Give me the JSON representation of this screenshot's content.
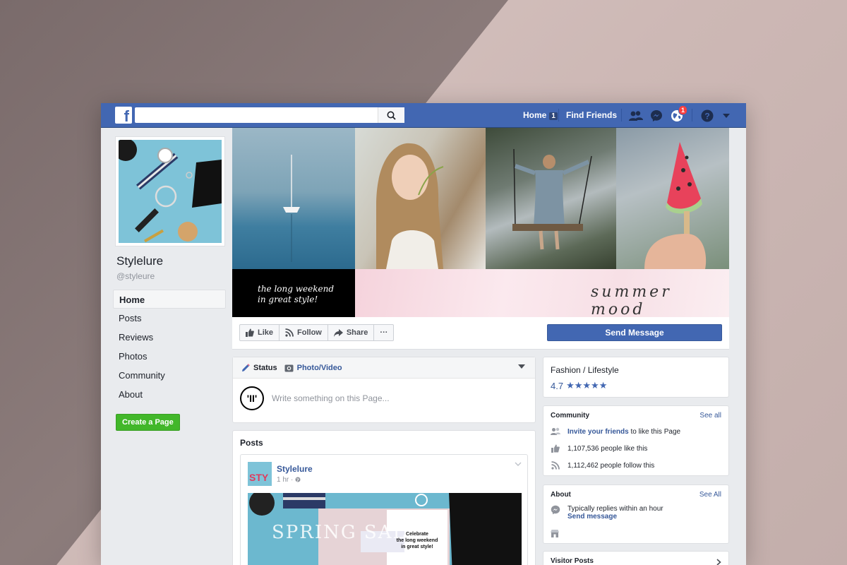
{
  "topbar": {
    "logo": "f",
    "search_placeholder": "",
    "home_label": "Home",
    "home_count": "1",
    "find_friends_label": "Find Friends",
    "notification_count": "1"
  },
  "page": {
    "name": "Stylelure",
    "handle": "@styleure"
  },
  "left_nav": {
    "items": [
      "Home",
      "Posts",
      "Reviews",
      "Photos",
      "Community",
      "About"
    ],
    "create_page": "Create a Page"
  },
  "cover": {
    "black_line1": "the long weekend",
    "black_line2": "in great style!",
    "script_text": "summer mood"
  },
  "actions": {
    "like": "Like",
    "follow": "Follow",
    "share": "Share",
    "more": "···",
    "send_message": "Send Message"
  },
  "composer": {
    "status_tab": "Status",
    "photo_tab": "Photo/Video",
    "avatar_text": "'II'",
    "placeholder": "Write something on this Page..."
  },
  "posts": {
    "title": "Posts",
    "author": "Stylelure",
    "time": "1 hr · ",
    "avatar_text": "STY",
    "image_text_big": "SPRING SALE",
    "image_card_line1": "Celebrate",
    "image_card_line2": "the long weekend",
    "image_card_line3": "in great style!"
  },
  "category": {
    "title": "Fashion / Lifestyle",
    "rating": "4.7",
    "stars": "★★★★★"
  },
  "community": {
    "header": "Community",
    "see_all": "See all",
    "invite_link": "Invite your friends",
    "invite_rest": " to like this Page",
    "likes": "1,107,536 people like this",
    "follows": "1,112,462 people follow this"
  },
  "about": {
    "header": "About",
    "see_all": "See All",
    "replies": "Typically replies within an hour",
    "send_message": "Send message"
  },
  "visitor_posts": {
    "header": "Visitor Posts"
  },
  "colors": {
    "fb_blue": "#4267b2",
    "link_blue": "#365899",
    "green": "#42b72a",
    "bg": "#e9ebee"
  }
}
